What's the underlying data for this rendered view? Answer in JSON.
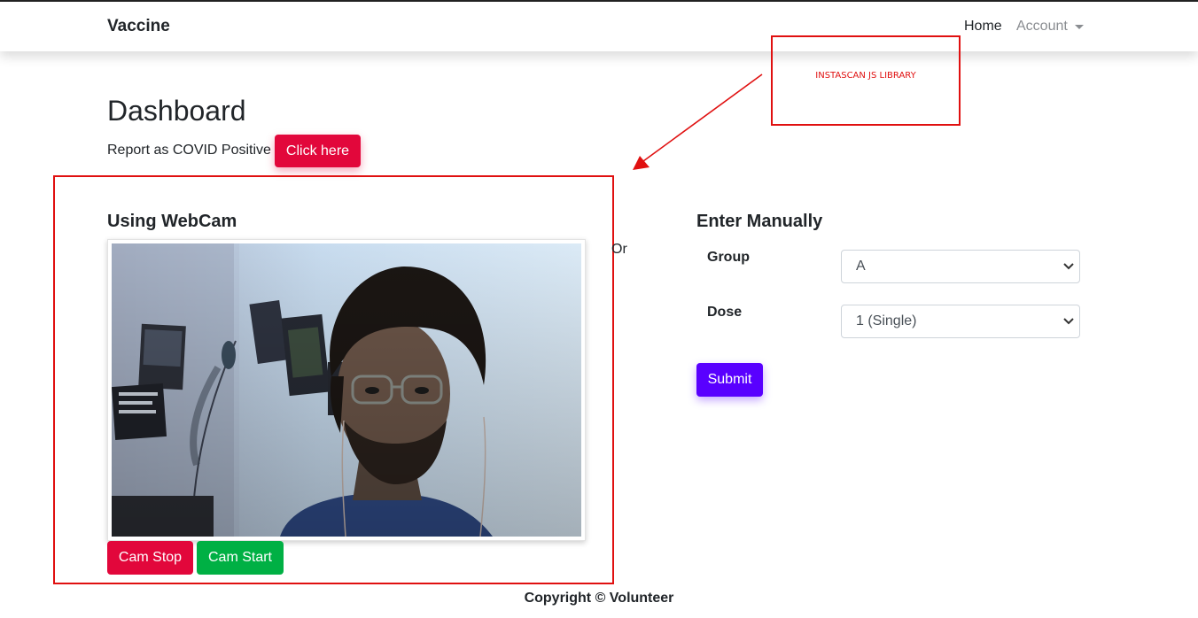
{
  "navbar": {
    "brand": "Vaccine",
    "home_label": "Home",
    "account_label": "Account"
  },
  "annotation": {
    "label": "INSTASCAN JS LIBRARY",
    "color": "#e01010"
  },
  "dashboard": {
    "title": "Dashboard",
    "report_text": "Report as COVID Positive",
    "click_here_label": "Click here"
  },
  "webcam": {
    "title": "Using WebCam",
    "cam_stop_label": "Cam Stop",
    "cam_start_label": "Cam Start"
  },
  "separator": {
    "or_text": "Or"
  },
  "manual": {
    "title": "Enter Manually",
    "group_label": "Group",
    "group_value": "A",
    "dose_label": "Dose",
    "dose_value": "1 (Single)",
    "submit_label": "Submit"
  },
  "footer": {
    "copyright": "Copyright © Volunteer"
  },
  "colors": {
    "danger": "#e2073b",
    "success": "#00b044",
    "primary": "#5900ff"
  }
}
